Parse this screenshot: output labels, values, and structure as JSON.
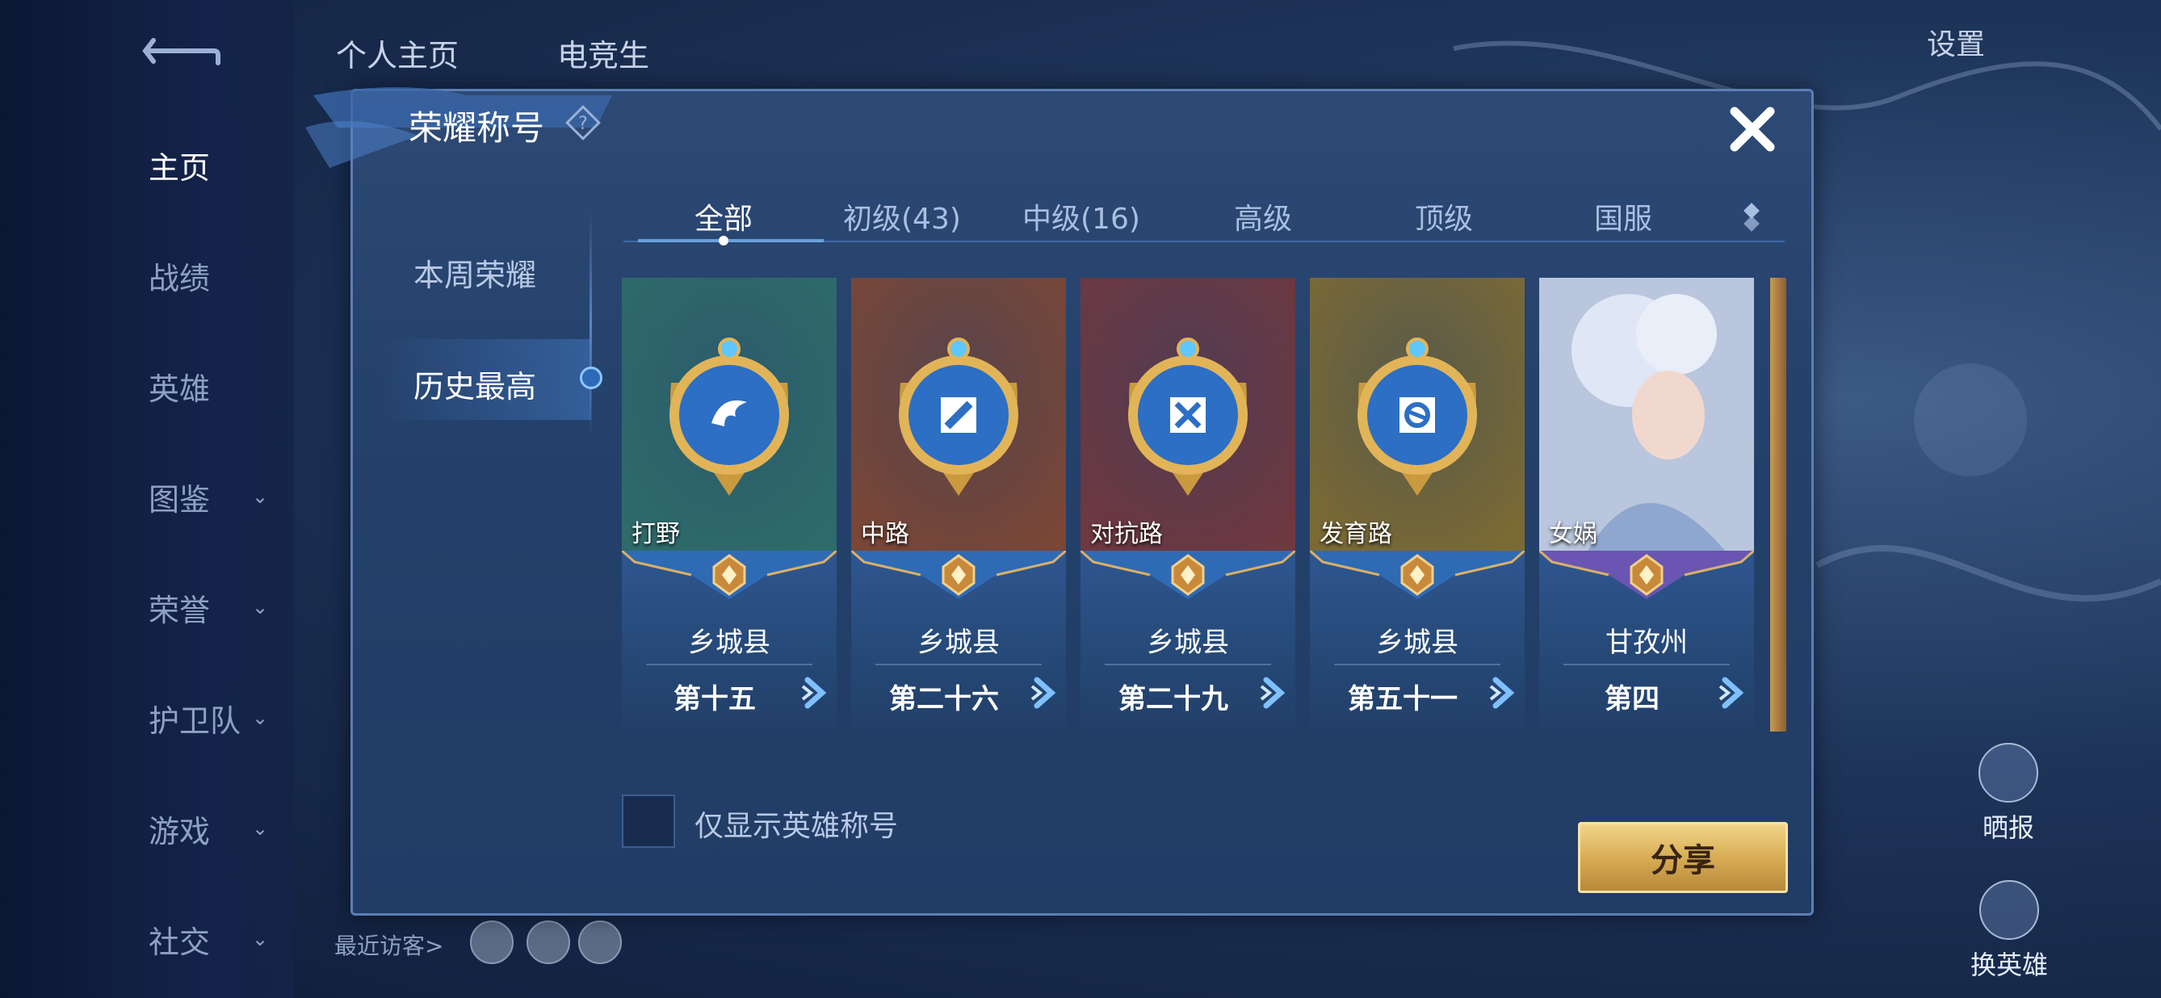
{
  "background": {
    "top_tabs": [
      "个人主页",
      "电竞生"
    ],
    "settings_label": "设置",
    "left_nav": [
      {
        "label": "主页",
        "active": true,
        "has_chevron": false
      },
      {
        "label": "战绩",
        "active": false,
        "has_chevron": false
      },
      {
        "label": "英雄",
        "active": false,
        "has_chevron": false
      },
      {
        "label": "图鉴",
        "active": false,
        "has_chevron": true
      },
      {
        "label": "荣誉",
        "active": false,
        "has_chevron": true
      },
      {
        "label": "护卫队",
        "active": false,
        "has_chevron": true
      },
      {
        "label": "游戏",
        "active": false,
        "has_chevron": true
      },
      {
        "label": "社交",
        "active": false,
        "has_chevron": true
      }
    ],
    "recent_visitors_label": "最近访客>",
    "right_buttons": [
      "晒报",
      "换英雄"
    ]
  },
  "modal": {
    "title": "荣耀称号",
    "side_tabs": [
      {
        "label": "本周荣耀",
        "active": false
      },
      {
        "label": "历史最高",
        "active": true
      }
    ],
    "tabs": [
      {
        "label": "全部",
        "active": true
      },
      {
        "label": "初级(43)",
        "active": false
      },
      {
        "label": "中级(16)",
        "active": false
      },
      {
        "label": "高级",
        "active": false
      },
      {
        "label": "顶级",
        "active": false
      },
      {
        "label": "国服",
        "active": false
      }
    ],
    "cards": [
      {
        "category": "打野",
        "region": "乡城县",
        "rank": "第十五",
        "icon": "dragon-icon",
        "art_color": "#2f6b6a",
        "banner_color": "#2f6ab5"
      },
      {
        "category": "中路",
        "region": "乡城县",
        "rank": "第二十六",
        "icon": "wand-icon",
        "art_color": "#7a4636",
        "banner_color": "#2f6ab5"
      },
      {
        "category": "对抗路",
        "region": "乡城县",
        "rank": "第二十九",
        "icon": "crossed-swords-icon",
        "art_color": "#6e3840",
        "banner_color": "#2f6ab5"
      },
      {
        "category": "发育路",
        "region": "乡城县",
        "rank": "第五十一",
        "icon": "target-icon",
        "art_color": "#7b6a34",
        "banner_color": "#2f6ab5"
      },
      {
        "category": "女娲",
        "region": "甘孜州",
        "rank": "第四",
        "icon": "hero-portrait-icon",
        "art_color": "#b9c6dd",
        "banner_color": "#6a56b2"
      }
    ],
    "checkbox_label": "仅显示英雄称号",
    "checkbox_checked": false,
    "share_label": "分享"
  }
}
